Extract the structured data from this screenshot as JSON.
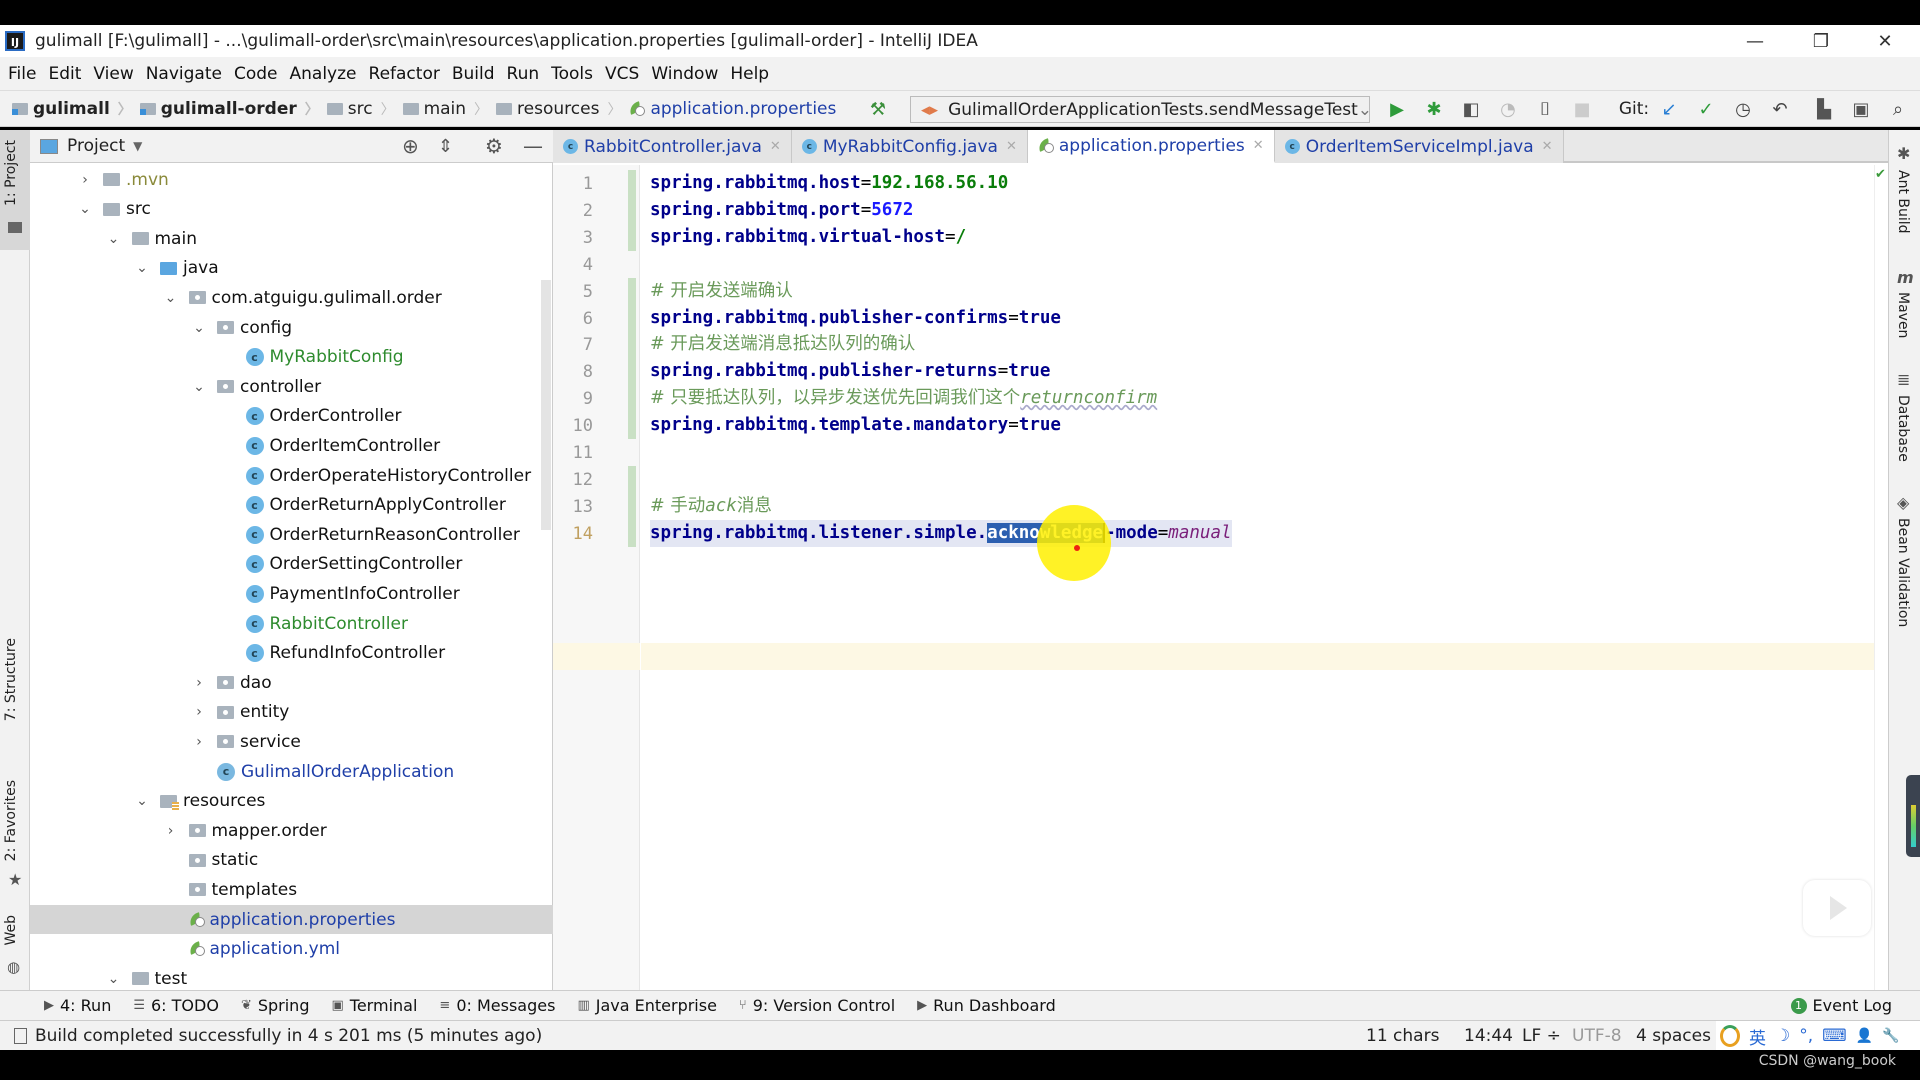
{
  "window": {
    "title": "gulimall [F:\\gulimall] - ...\\gulimall-order\\src\\main\\resources\\application.properties [gulimall-order] - IntelliJ IDEA",
    "logo": "IJ",
    "controls": {
      "minimize": "—",
      "maximize": "❐",
      "close": "✕"
    }
  },
  "menu": [
    "File",
    "Edit",
    "View",
    "Navigate",
    "Code",
    "Analyze",
    "Refactor",
    "Build",
    "Run",
    "Tools",
    "VCS",
    "Window",
    "Help"
  ],
  "breadcrumb": [
    {
      "label": "gulimall",
      "type": "module"
    },
    {
      "label": "gulimall-order",
      "type": "module"
    },
    {
      "label": "src",
      "type": "folder"
    },
    {
      "label": "main",
      "type": "folder"
    },
    {
      "label": "resources",
      "type": "resources"
    },
    {
      "label": "application.properties",
      "type": "file"
    }
  ],
  "toolbar": {
    "run_config": "GulimallOrderApplicationTests.sendMessageTest",
    "git_label": "Git:",
    "icons": [
      "build-hammer-icon",
      "run-icon",
      "debug-icon",
      "coverage-icon",
      "profile-icon",
      "attach-debugger-icon",
      "stop-icon",
      "git-update-icon",
      "git-commit-icon",
      "history-icon",
      "rollback-icon",
      "project-structure-icon",
      "terminal-window-icon",
      "search-icon"
    ]
  },
  "left_strip": {
    "project": "1: Project",
    "structure": "7: Structure",
    "favorites": "2: Favorites",
    "web": "Web"
  },
  "project_panel": {
    "title": "Project",
    "tree": [
      {
        "label": ".mvn",
        "depth": 2,
        "chev": "›",
        "icon": "folder",
        "color": "olive"
      },
      {
        "label": "src",
        "depth": 2,
        "chev": "⌄",
        "icon": "folder"
      },
      {
        "label": "main",
        "depth": 3,
        "chev": "⌄",
        "icon": "folder"
      },
      {
        "label": "java",
        "depth": 4,
        "chev": "⌄",
        "icon": "src"
      },
      {
        "label": "com.atguigu.gulimall.order",
        "depth": 5,
        "chev": "⌄",
        "icon": "pkg"
      },
      {
        "label": "config",
        "depth": 6,
        "chev": "⌄",
        "icon": "pkg"
      },
      {
        "label": "MyRabbitConfig",
        "depth": 7,
        "chev": "",
        "icon": "class",
        "color": "green"
      },
      {
        "label": "controller",
        "depth": 6,
        "chev": "⌄",
        "icon": "pkg"
      },
      {
        "label": "OrderController",
        "depth": 7,
        "chev": "",
        "icon": "class"
      },
      {
        "label": "OrderItemController",
        "depth": 7,
        "chev": "",
        "icon": "class"
      },
      {
        "label": "OrderOperateHistoryController",
        "depth": 7,
        "chev": "",
        "icon": "class"
      },
      {
        "label": "OrderReturnApplyController",
        "depth": 7,
        "chev": "",
        "icon": "class"
      },
      {
        "label": "OrderReturnReasonController",
        "depth": 7,
        "chev": "",
        "icon": "class"
      },
      {
        "label": "OrderSettingController",
        "depth": 7,
        "chev": "",
        "icon": "class"
      },
      {
        "label": "PaymentInfoController",
        "depth": 7,
        "chev": "",
        "icon": "class"
      },
      {
        "label": "RabbitController",
        "depth": 7,
        "chev": "",
        "icon": "class",
        "color": "green"
      },
      {
        "label": "RefundInfoController",
        "depth": 7,
        "chev": "",
        "icon": "class"
      },
      {
        "label": "dao",
        "depth": 6,
        "chev": "›",
        "icon": "pkg"
      },
      {
        "label": "entity",
        "depth": 6,
        "chev": "›",
        "icon": "pkg"
      },
      {
        "label": "service",
        "depth": 6,
        "chev": "›",
        "icon": "pkg"
      },
      {
        "label": "GulimallOrderApplication",
        "depth": 6,
        "chev": "",
        "icon": "spring-class",
        "color": "blue"
      },
      {
        "label": "resources",
        "depth": 4,
        "chev": "⌄",
        "icon": "res"
      },
      {
        "label": "mapper.order",
        "depth": 5,
        "chev": "›",
        "icon": "pkg"
      },
      {
        "label": "static",
        "depth": 5,
        "chev": "",
        "icon": "pkg"
      },
      {
        "label": "templates",
        "depth": 5,
        "chev": "",
        "icon": "pkg"
      },
      {
        "label": "application.properties",
        "depth": 5,
        "chev": "",
        "icon": "spring",
        "color": "blue",
        "selected": true
      },
      {
        "label": "application.yml",
        "depth": 5,
        "chev": "",
        "icon": "spring",
        "color": "blue"
      },
      {
        "label": "test",
        "depth": 3,
        "chev": "⌄",
        "icon": "folder"
      }
    ]
  },
  "editor": {
    "tabs": [
      {
        "label": "RabbitController.java",
        "icon": "class",
        "active": false
      },
      {
        "label": "MyRabbitConfig.java",
        "icon": "class",
        "active": false
      },
      {
        "label": "application.properties",
        "icon": "spring",
        "active": true
      },
      {
        "label": "OrderItemServiceImpl.java",
        "icon": "class",
        "active": false
      }
    ],
    "lines": [
      {
        "n": "1",
        "key": "spring.rabbitmq.host",
        "eq": "=",
        "value": "192.168.56.10",
        "vtype": "val"
      },
      {
        "n": "2",
        "key": "spring.rabbitmq.port",
        "eq": "=",
        "value": "5672",
        "vtype": "num"
      },
      {
        "n": "3",
        "key": "spring.rabbitmq.virtual-host",
        "eq": "=",
        "value": "/",
        "vtype": "val"
      },
      {
        "n": "4"
      },
      {
        "n": "5",
        "comment": "# 开启发送端确认"
      },
      {
        "n": "6",
        "key": "spring.rabbitmq.publisher-confirms",
        "eq": "=",
        "value": "true",
        "vtype": "kw"
      },
      {
        "n": "7",
        "comment": "# 开启发送端消息抵达队列的确认"
      },
      {
        "n": "8",
        "key": "spring.rabbitmq.publisher-returns",
        "eq": "=",
        "value": "true",
        "vtype": "kw"
      },
      {
        "n": "9",
        "comment": "# 只要抵达队列，以异步发送优先回调我们这个",
        "comment_tail": "returnconfirm"
      },
      {
        "n": "10",
        "key": "spring.rabbitmq.template.mandatory",
        "eq": "=",
        "value": "true",
        "vtype": "kw"
      },
      {
        "n": "11"
      },
      {
        "n": "12"
      },
      {
        "n": "13",
        "comment": "# 手动",
        "comment_mid": "ack",
        "comment_end": "消息"
      },
      {
        "n": "14",
        "key_pre": "spring.rabbitmq.listener.simple.",
        "key_sel": "acknowledge",
        "key_post": "-mode",
        "eq": "=",
        "value": "manual",
        "vtype": "it"
      }
    ]
  },
  "right_strip": [
    "Ant Build",
    "Maven",
    "Database",
    "Bean Validation"
  ],
  "bottom_tools": [
    {
      "label": "4: Run",
      "icon": "▶"
    },
    {
      "label": "6: TODO",
      "icon": "☰"
    },
    {
      "label": "Spring",
      "icon": "❦"
    },
    {
      "label": "Terminal",
      "icon": "▣"
    },
    {
      "label": "0: Messages",
      "icon": "≡"
    },
    {
      "label": "Java Enterprise",
      "icon": "▥"
    },
    {
      "label": "9: Version Control",
      "icon": "⑂"
    },
    {
      "label": "Run Dashboard",
      "icon": "▶"
    }
  ],
  "event_log": {
    "label": "Event Log",
    "count": "1"
  },
  "status": {
    "message": "Build completed successfully in 4 s 201 ms (5 minutes ago)",
    "chars": "11 chars",
    "position": "14:44",
    "line_sep": "LF ÷",
    "encoding": "UTF-8",
    "indent": "4 spaces",
    "ime": [
      "英",
      "☽",
      "°,",
      "⌨",
      "👤",
      "🔧"
    ]
  },
  "watermark": "CSDN @wang_book"
}
